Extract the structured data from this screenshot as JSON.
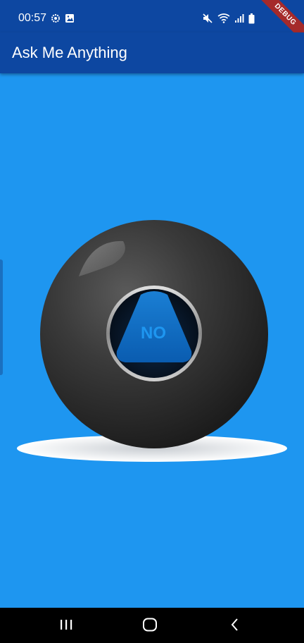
{
  "status_bar": {
    "time": "00:57",
    "left_icons": [
      "settings-icon",
      "image-icon"
    ],
    "right_icons": [
      "mute-icon",
      "wifi-icon",
      "signal-icon",
      "battery-icon"
    ],
    "debug_label": "DEBUG"
  },
  "app_bar": {
    "title": "Ask Me Anything"
  },
  "ball": {
    "answer": "NO"
  },
  "nav_bar": {
    "buttons": [
      "recent-apps-icon",
      "home-icon",
      "back-icon"
    ]
  },
  "colors": {
    "background": "#1e96f0",
    "app_bar": "#0d47a1",
    "answer_text": "#1e96f0",
    "debug_ribbon": "#a52a2a"
  }
}
